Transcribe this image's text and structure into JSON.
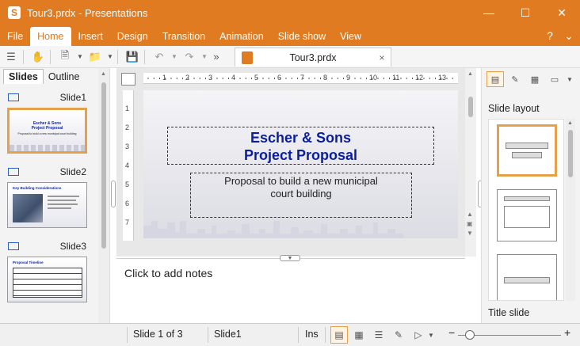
{
  "window": {
    "title": "Tour3.prdx - Presentations",
    "app_icon_letter": "S",
    "minimize_icon": "minimize-icon",
    "maximize_icon": "maximize-icon",
    "close_icon": "close-icon"
  },
  "ribbon": {
    "tabs": [
      "File",
      "Home",
      "Insert",
      "Design",
      "Transition",
      "Animation",
      "Slide show",
      "View"
    ],
    "active_tab": "Home",
    "help_label": "?",
    "collapse_label": "⌄"
  },
  "toolbar": {
    "document_tab": "Tour3.prdx",
    "document_close": "×"
  },
  "left_panel": {
    "tabs": [
      "Slides",
      "Outline"
    ],
    "active_tab": "Slides",
    "slides": [
      {
        "label": "Slide1",
        "thumb_title": "Escher & Sons",
        "thumb_subtitle": "Project Proposal",
        "thumb_text": "Proposal to build a new municipal court building"
      },
      {
        "label": "Slide2",
        "thumb_title": "Key Building Considerations"
      },
      {
        "label": "Slide3",
        "thumb_title": "Proposal Timeline"
      }
    ]
  },
  "editor": {
    "ruler_h_marks": [
      "1",
      "2",
      "3",
      "4",
      "5",
      "6",
      "7",
      "8",
      "9",
      "10",
      "11",
      "12",
      "13"
    ],
    "ruler_v_marks": [
      "1",
      "2",
      "3",
      "4",
      "5",
      "6",
      "7"
    ],
    "slide_title_line1": "Escher & Sons",
    "slide_title_line2": "Project Proposal",
    "slide_subtitle_line1": "Proposal to build a new municipal",
    "slide_subtitle_line2": "court building"
  },
  "notes": {
    "placeholder": "Click to add notes"
  },
  "right_panel": {
    "heading": "Slide layout",
    "footer": "Title slide"
  },
  "status": {
    "slide_position": "Slide 1 of 3",
    "slide_name": "Slide1",
    "insert_mode": "Ins"
  },
  "colors": {
    "accent": "#e07b22",
    "title_blue": "#0b1f9e",
    "selection": "#e5a04a"
  }
}
